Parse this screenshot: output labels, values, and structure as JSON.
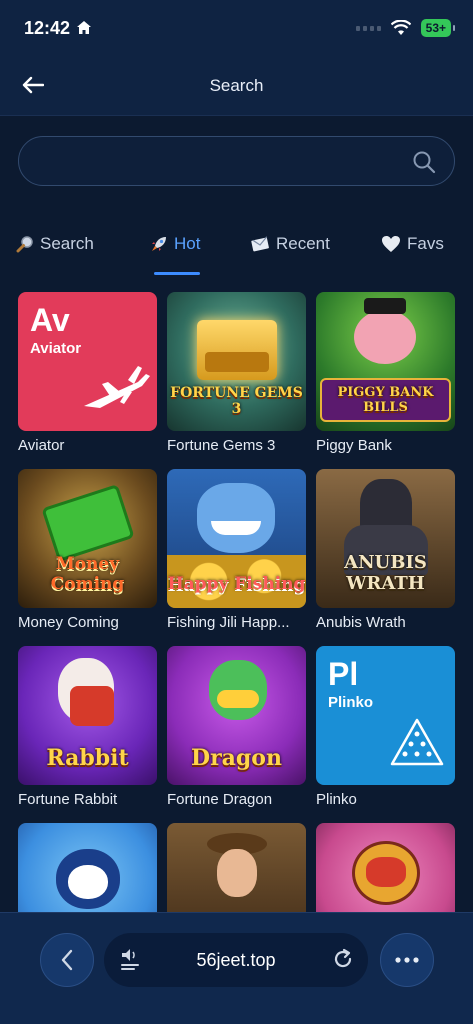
{
  "status": {
    "time": "12:42",
    "battery": "53+"
  },
  "header": {
    "title": "Search"
  },
  "search": {
    "placeholder": "",
    "value": ""
  },
  "tabs": [
    {
      "label": "Search",
      "icon": "magnifier-icon"
    },
    {
      "label": "Hot",
      "icon": "rocket-icon",
      "active": true
    },
    {
      "label": "Recent",
      "icon": "envelope-icon"
    },
    {
      "label": "Favs",
      "icon": "heart-icon"
    }
  ],
  "games": [
    {
      "label": "Aviator",
      "badge": "Av",
      "badge_sub": "Aviator",
      "color": "#e23b5a"
    },
    {
      "label": "Fortune Gems 3",
      "art": "FORTUNE GEMS 3",
      "color": "#2f6b5e"
    },
    {
      "label": "Piggy Bank",
      "art": "PIGGY BANK BILLS",
      "color": "#2c7a2a"
    },
    {
      "label": "Money Coming",
      "art": "Money Coming",
      "color": "#5a3d1d"
    },
    {
      "label": "Fishing Jili Happ...",
      "art": "Happy Fishing",
      "color": "#2e6ab8"
    },
    {
      "label": "Anubis Wrath",
      "art": "ANUBIS WRATH",
      "color": "#6b5238"
    },
    {
      "label": "Fortune Rabbit",
      "art": "Rabbit",
      "color": "#7a33c9"
    },
    {
      "label": "Fortune Dragon",
      "art": "Dragon",
      "color": "#8b2cb8"
    },
    {
      "label": "Plinko",
      "badge": "Pl",
      "badge_sub": "Plinko",
      "color": "#1a8fd6"
    },
    {
      "label": "",
      "color": "#3c8fe0"
    },
    {
      "label": "",
      "color": "#6b4a2b"
    },
    {
      "label": "",
      "color": "#c84a8e"
    }
  ],
  "browser": {
    "url": "56jeet.top"
  }
}
